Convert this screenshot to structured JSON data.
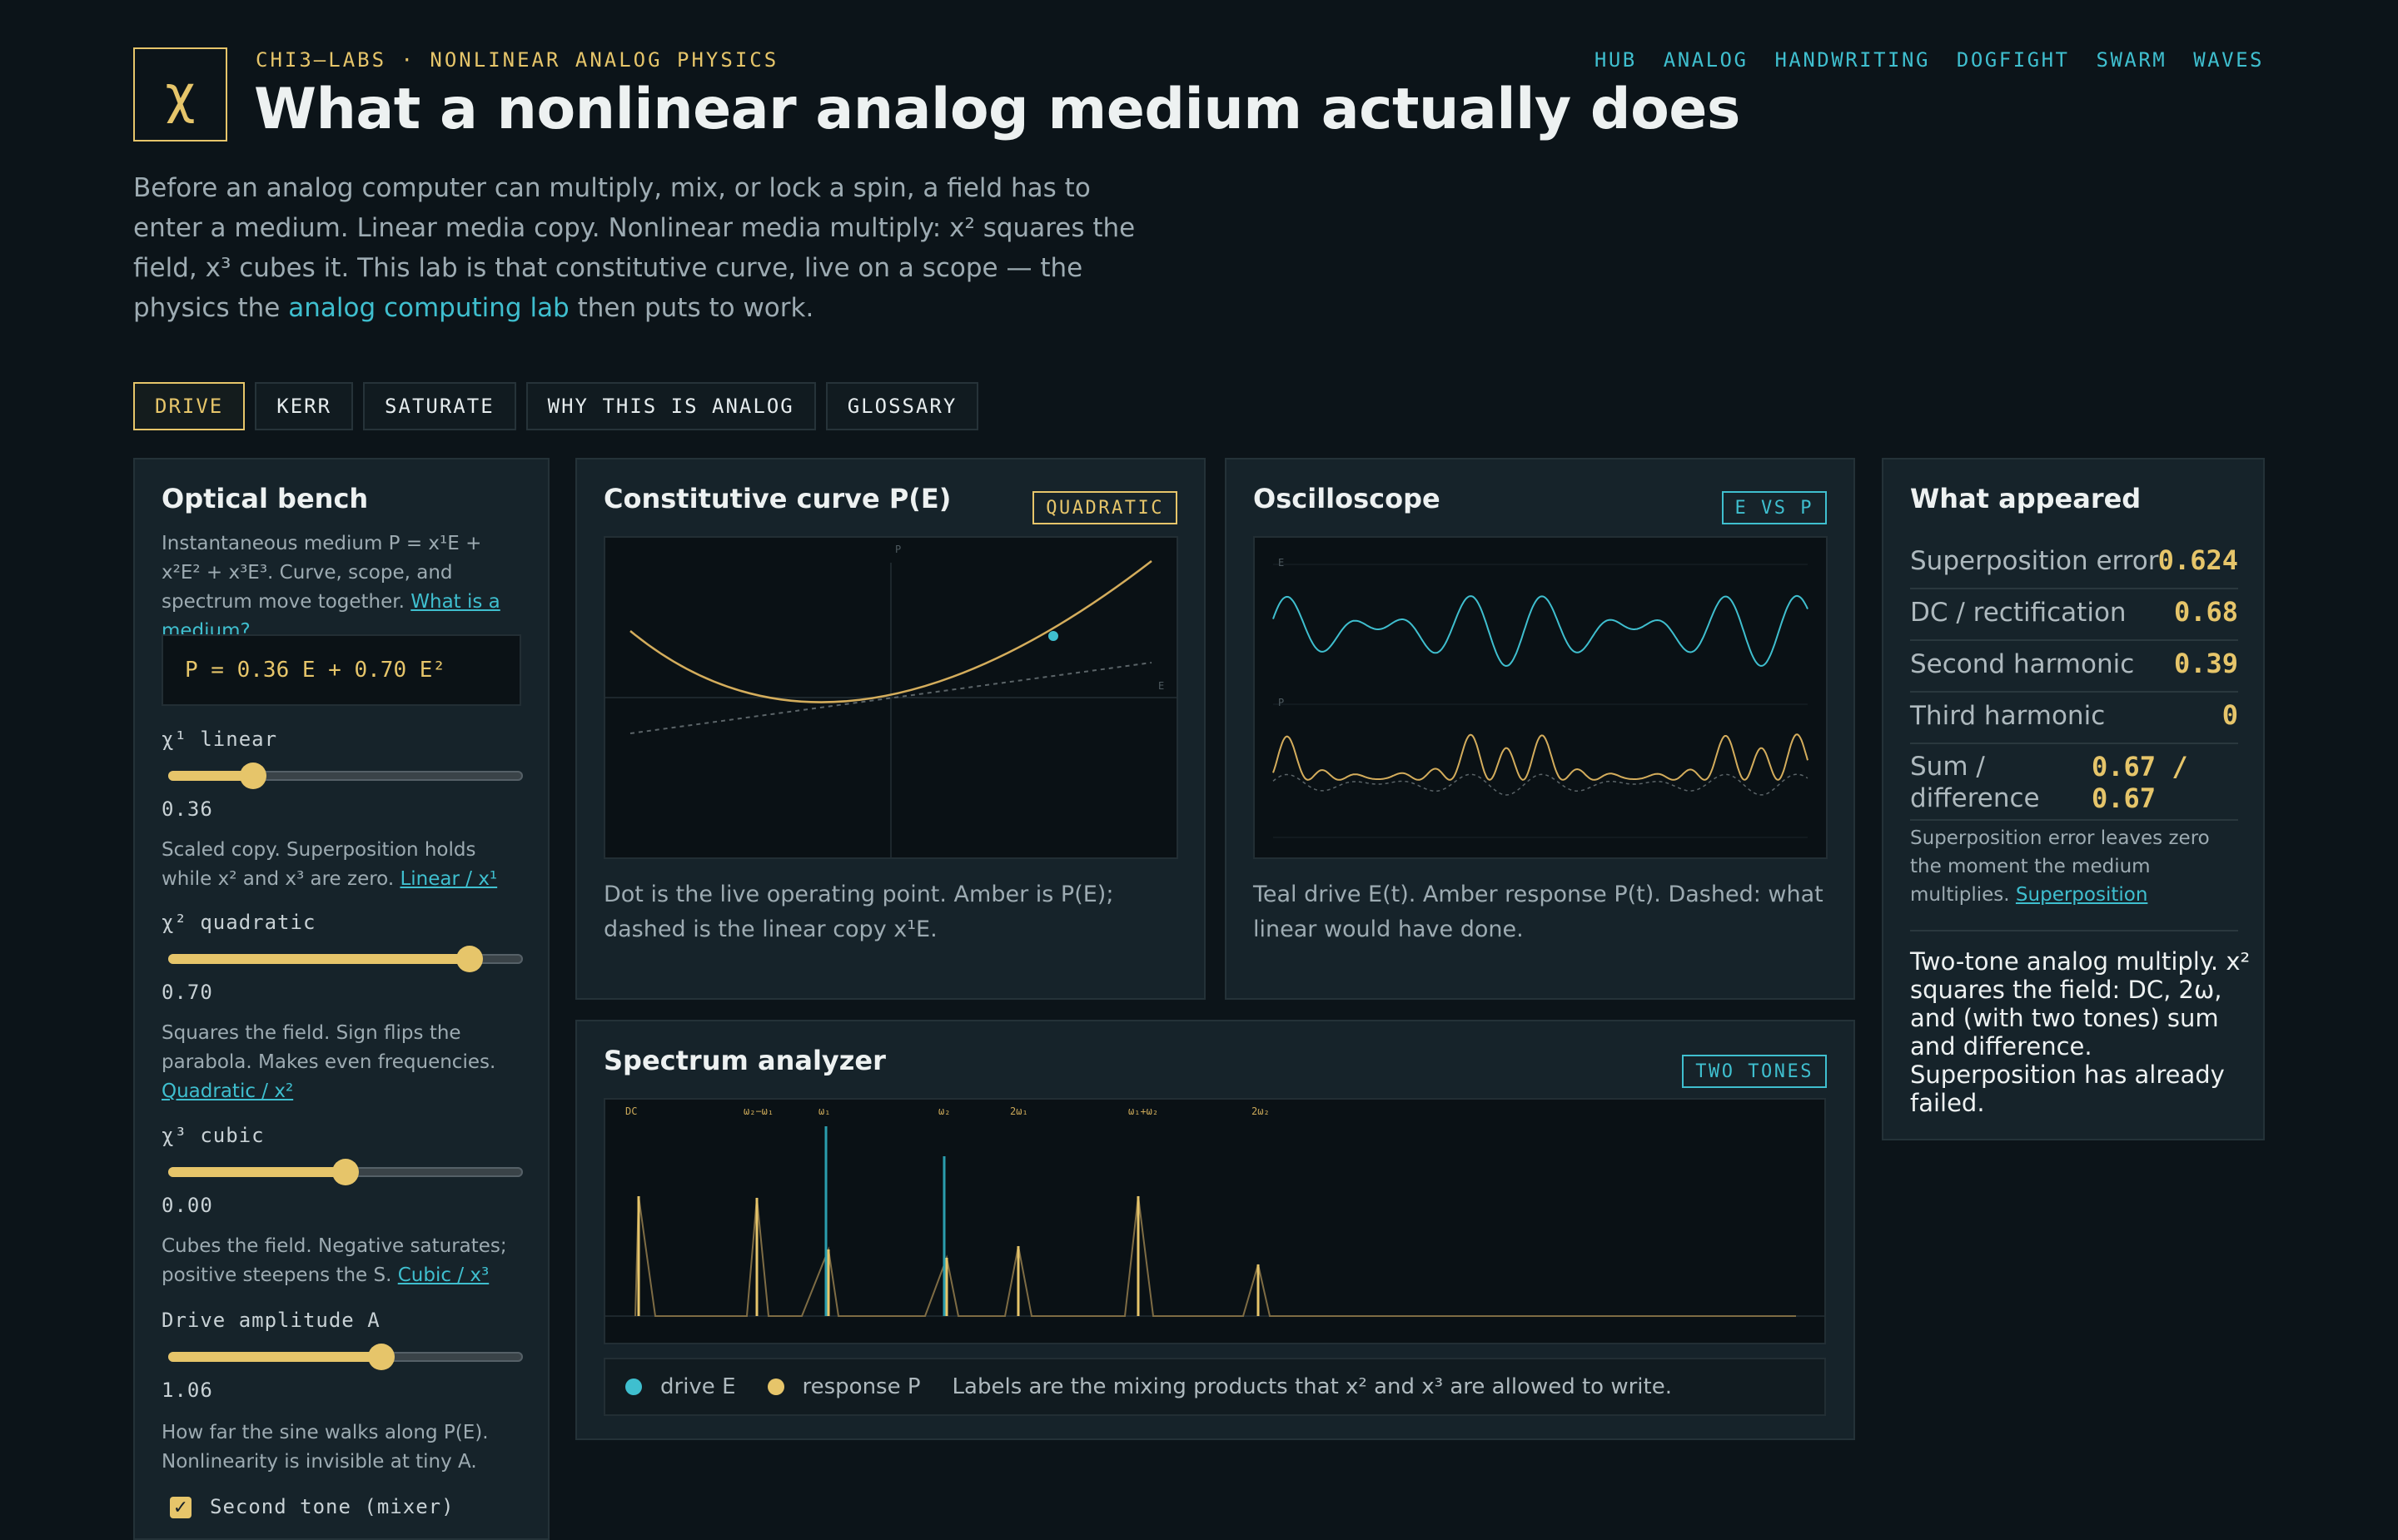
{
  "header": {
    "logo": "χ",
    "kicker": "CHI3–LABS · NONLINEAR ANALOG PHYSICS",
    "title": "What a nonlinear analog medium actually does",
    "nav": [
      "HUB",
      "ANALOG",
      "HANDWRITING",
      "DOGFIGHT",
      "SWARM",
      "WAVES"
    ],
    "intro_text": "Before an analog computer can multiply, mix, or lock a spin, a field has to enter a medium. Linear media copy. Nonlinear media multiply: x² squares the field, x³ cubes it. This lab is that constitutive curve, live on a scope — the physics the",
    "intro_link": "analog computing lab",
    "intro_tail": "then puts to work."
  },
  "tabs": [
    {
      "label": "DRIVE",
      "active": true
    },
    {
      "label": "KERR",
      "active": false
    },
    {
      "label": "SATURATE",
      "active": false
    },
    {
      "label": "WHY THIS IS ANALOG",
      "active": false
    },
    {
      "label": "GLOSSARY",
      "active": false
    }
  ],
  "bench": {
    "title": "Optical bench",
    "desc": "Instantaneous medium P = x¹E + x²E² + x³E³. Curve, scope, and spectrum move together.",
    "desc_link": "What is a medium?",
    "formula": "P = 0.36 E + 0.70 E²",
    "sliders": [
      {
        "label": "χ¹ linear",
        "value": "0.36",
        "level": 0.24,
        "help": "Scaled copy. Superposition holds while x² and x³ are zero.",
        "link": "Linear / x¹"
      },
      {
        "label": "χ² quadratic",
        "value": "0.70",
        "level": 0.85,
        "help": "Squares the field. Sign flips the parabola. Makes even frequencies.",
        "link": "Quadratic / x²"
      },
      {
        "label": "χ³ cubic",
        "value": "0.00",
        "level": 0.5,
        "help": "Cubes the field. Negative saturates; positive steepens the S.",
        "link": "Cubic / x³"
      },
      {
        "label": "Drive amplitude A",
        "value": "1.06",
        "level": 0.6,
        "help": "How far the sine walks along P(E). Nonlinearity is invisible at tiny A.",
        "link": ""
      }
    ],
    "checkbox_label": "Second tone (mixer)",
    "checkbox_checked": true
  },
  "curve": {
    "title": "Constitutive curve P(E)",
    "badge": "QUADRATIC",
    "axis_p": "P",
    "axis_e": "E",
    "caption": "Dot is the live operating point. Amber is P(E); dashed is the linear copy x¹E."
  },
  "scope": {
    "title": "Oscilloscope",
    "badge": "E VS P",
    "label_e": "E",
    "label_p": "P",
    "caption": "Teal drive E(t). Amber response P(t). Dashed: what linear would have done."
  },
  "spectrum": {
    "title": "Spectrum analyzer",
    "badge": "TWO TONES",
    "peak_labels": [
      "DC",
      "ω₂−ω₁",
      "ω₁",
      "ω₂",
      "2ω₁",
      "ω₁+ω₂",
      "2ω₂"
    ],
    "legend_drive": "drive E",
    "legend_response": "response P",
    "legend_note": "Labels are the mixing products that x² and x³ are allowed to write."
  },
  "appeared": {
    "title": "What appeared",
    "metrics": [
      {
        "label": "Superposition error",
        "value": "0.624"
      },
      {
        "label": "DC / rectification",
        "value": "0.68"
      },
      {
        "label": "Second harmonic",
        "value": "0.39"
      },
      {
        "label": "Third harmonic",
        "value": "0"
      }
    ],
    "sum_label": "Sum / difference",
    "sum_value": "0.67 / 0.67",
    "note": "Superposition error leaves zero the moment the medium multiplies.",
    "note_link": "Superposition",
    "summary": "Two-tone analog multiply. x² squares the field: DC, 2ω, and (with two tones) sum and difference. Superposition has already failed."
  },
  "colors": {
    "accent_amber": "#e6c56a",
    "accent_teal": "#3fbfcf",
    "background": "#0c1419",
    "panel": "#16232a"
  }
}
